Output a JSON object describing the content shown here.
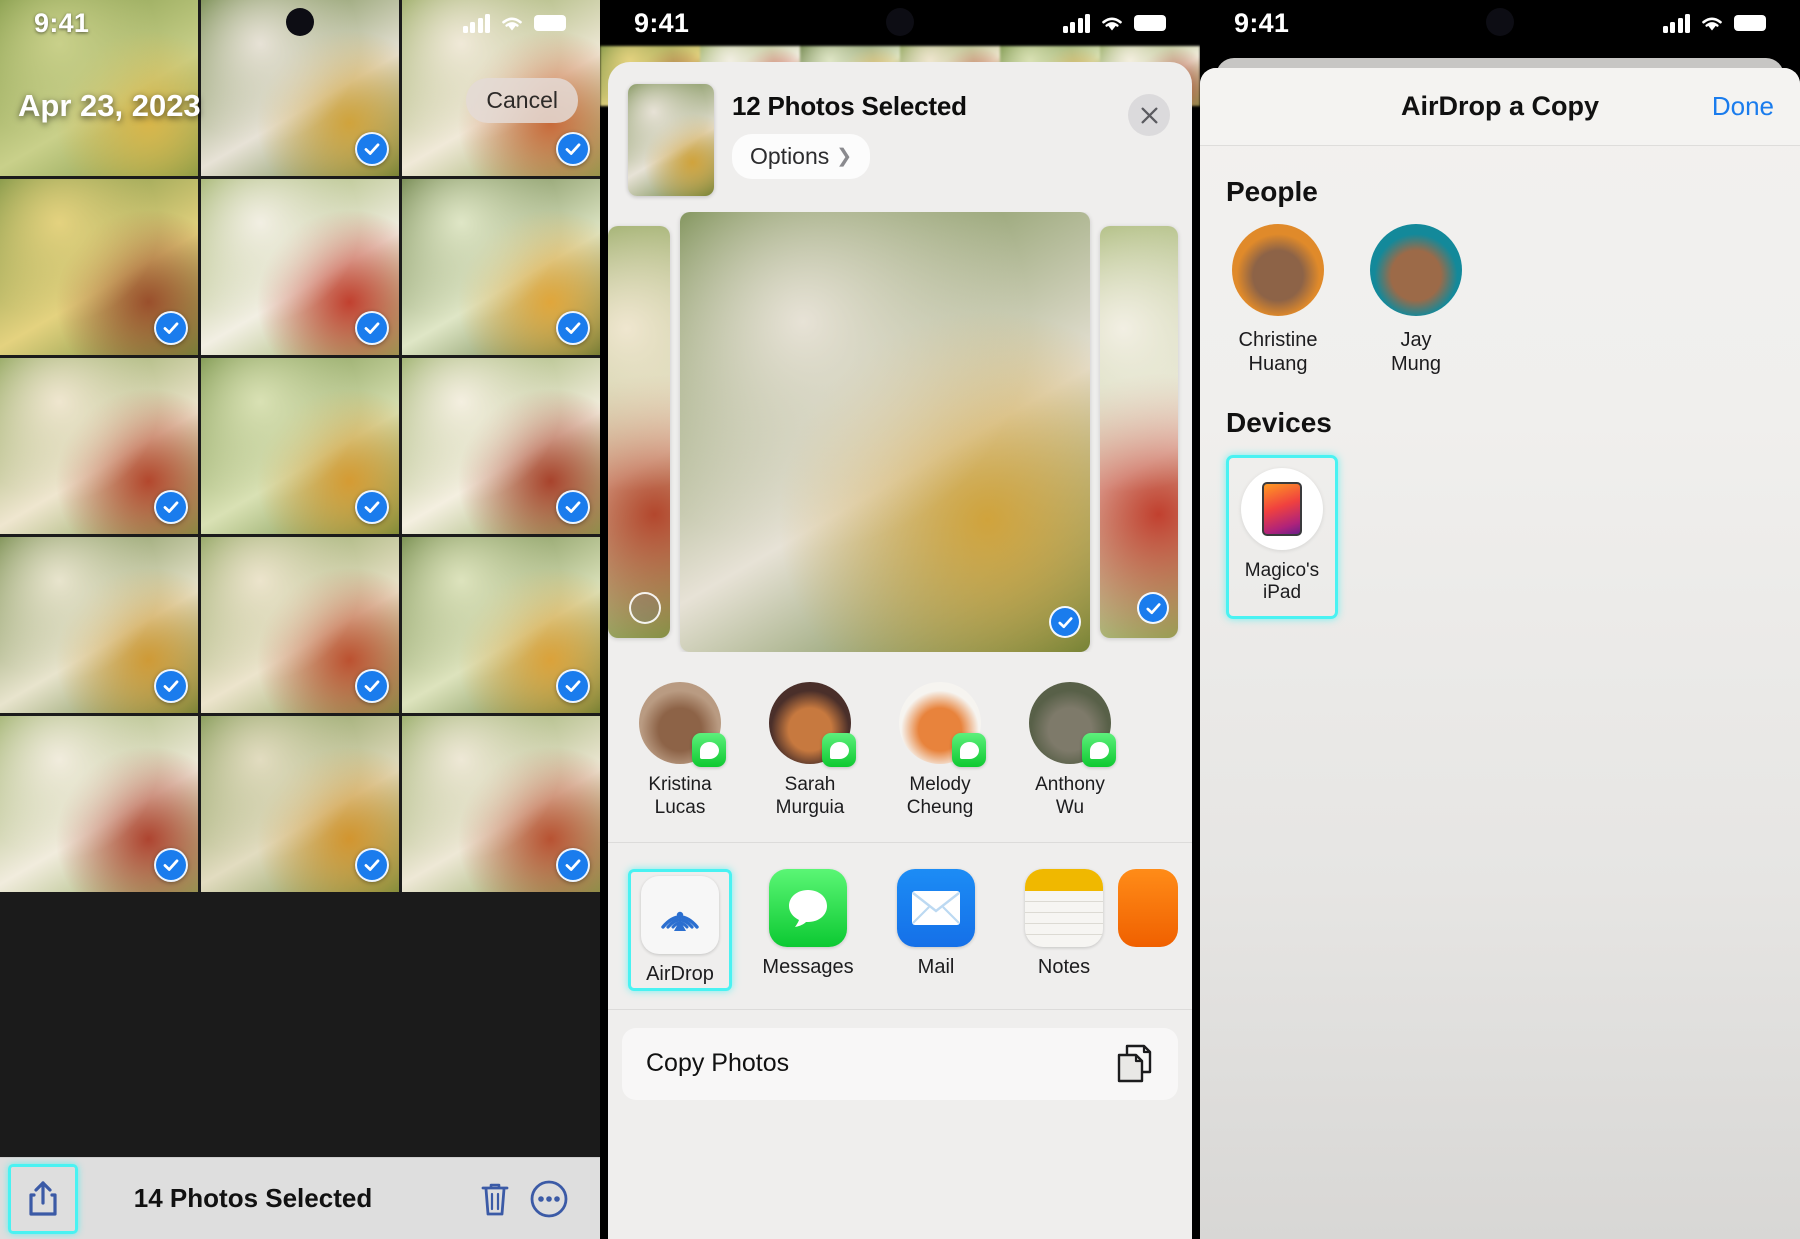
{
  "status_bar": {
    "time": "9:41",
    "signal_icon": "cellular-bars-icon",
    "wifi_icon": "wifi-icon",
    "battery_icon": "battery-icon"
  },
  "accent": {
    "ios_blue": "#1a7ced",
    "highlight_cyan": "#49f2f2",
    "messages_green": "#0cc932"
  },
  "panel1": {
    "date_label": "Apr 23, 2023",
    "cancel_label": "Cancel",
    "toolbar": {
      "share_icon": "share-icon",
      "count_label": "14 Photos Selected",
      "trash_icon": "trash-icon",
      "more_icon": "more-ellipsis-icon"
    },
    "grid": [
      {
        "selected": false
      },
      {
        "selected": true
      },
      {
        "selected": true
      },
      {
        "selected": true
      },
      {
        "selected": true
      },
      {
        "selected": true
      },
      {
        "selected": true
      },
      {
        "selected": true
      },
      {
        "selected": true
      },
      {
        "selected": true
      },
      {
        "selected": true
      },
      {
        "selected": true
      },
      {
        "selected": true
      },
      {
        "selected": true
      },
      {
        "selected": true
      }
    ]
  },
  "panel2": {
    "sheet_title": "12 Photos Selected",
    "options_label": "Options",
    "options_chevron": "chevron-right-icon",
    "close_icon": "close-icon",
    "thumbnail": "selected-photo-thumbnail",
    "carousel": [
      {
        "name": "photo-previous",
        "selected": false
      },
      {
        "name": "photo-current",
        "selected": true
      },
      {
        "name": "photo-next",
        "selected": true
      }
    ],
    "contacts": [
      {
        "name": "Kristina Lucas",
        "line1": "Kristina",
        "line2": "Lucas",
        "badge": "messages-badge-icon"
      },
      {
        "name": "Sarah Murguia",
        "line1": "Sarah",
        "line2": "Murguia",
        "badge": "messages-badge-icon"
      },
      {
        "name": "Melody Cheung",
        "line1": "Melody",
        "line2": "Cheung",
        "badge": "messages-badge-icon"
      },
      {
        "name": "Anthony Wu",
        "line1": "Anthony",
        "line2": "Wu",
        "badge": "messages-badge-icon"
      }
    ],
    "apps": [
      {
        "label": "AirDrop",
        "icon": "airdrop-icon",
        "highlighted": true
      },
      {
        "label": "Messages",
        "icon": "messages-icon",
        "highlighted": false
      },
      {
        "label": "Mail",
        "icon": "mail-icon",
        "highlighted": false
      },
      {
        "label": "Notes",
        "icon": "notes-icon",
        "highlighted": false
      }
    ],
    "action": {
      "label": "Copy Photos",
      "icon": "copy-icon"
    }
  },
  "panel3": {
    "title": "AirDrop a Copy",
    "done_label": "Done",
    "people_header": "People",
    "devices_header": "Devices",
    "people": [
      {
        "name": "Christine Huang",
        "line1": "Christine",
        "line2": "Huang",
        "bg": "#e08a2a"
      },
      {
        "name": "Jay Mung",
        "line1": "Jay",
        "line2": "Mung",
        "bg": "#13899a"
      }
    ],
    "devices": [
      {
        "name": "Magico's iPad",
        "icon": "ipad-icon",
        "highlighted": true
      }
    ]
  }
}
